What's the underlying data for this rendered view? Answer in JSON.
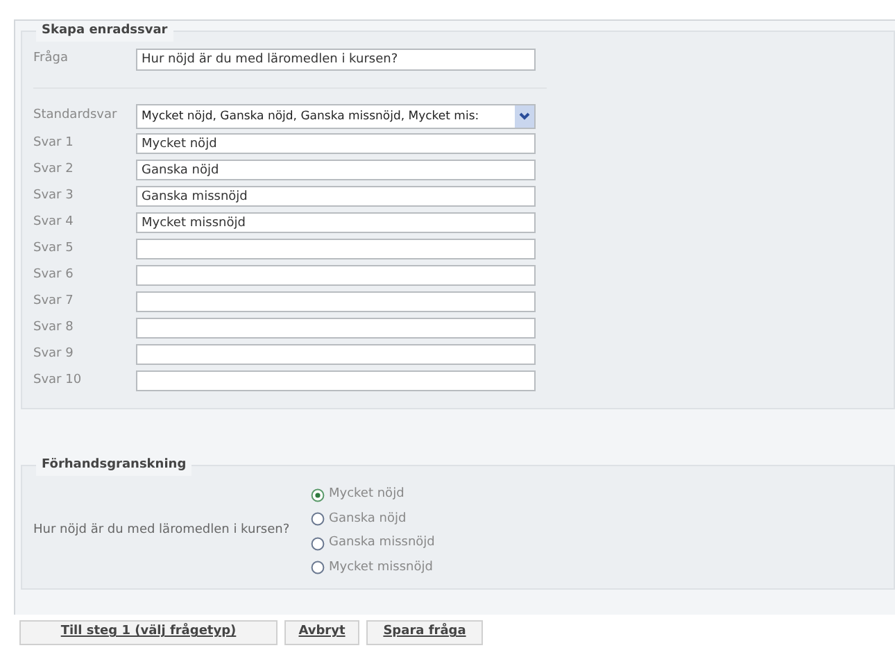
{
  "question_section": {
    "title": "Skapa enradssvar",
    "question": {
      "label": "Fråga",
      "value": "Hur nöjd är du med läromedlen i kursen?"
    },
    "standard": {
      "label": "Standardsvar",
      "value": "Mycket nöjd, Ganska nöjd, Ganska missnöjd, Mycket mis:"
    },
    "answers": [
      {
        "label": "Svar 1",
        "value": "Mycket nöjd"
      },
      {
        "label": "Svar 2",
        "value": "Ganska nöjd"
      },
      {
        "label": "Svar 3",
        "value": "Ganska missnöjd"
      },
      {
        "label": "Svar 4",
        "value": "Mycket missnöjd"
      },
      {
        "label": "Svar 5"
      },
      {
        "label": "Svar 6"
      },
      {
        "label": "Svar 7"
      },
      {
        "label": "Svar 8"
      },
      {
        "label": "Svar 9"
      },
      {
        "label": "Svar 10"
      }
    ]
  },
  "preview": {
    "title": "Förhandsgranskning",
    "question": "Hur nöjd är du med läromedlen i kursen?",
    "options": [
      {
        "label": "Mycket nöjd",
        "selected": true
      },
      {
        "label": "Ganska nöjd",
        "selected": false
      },
      {
        "label": "Ganska missnöjd",
        "selected": false
      },
      {
        "label": "Mycket missnöjd",
        "selected": false
      }
    ]
  },
  "buttons": [
    "Till steg 1 (välj frågetyp)",
    "Avbryt",
    "Spara fråga"
  ]
}
